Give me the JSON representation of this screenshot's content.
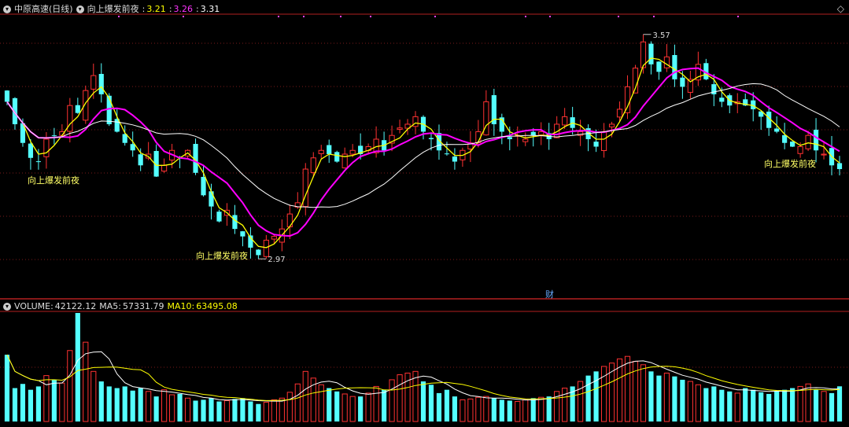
{
  "header": {
    "stock_name": "中原高速",
    "period": "(日线)",
    "indicator_name": "向上爆发前夜",
    "sep": ":",
    "values": [
      {
        "text": "3.21",
        "color": "#ffff00"
      },
      {
        "text": "3.26",
        "color": "#ff33ff"
      },
      {
        "text": "3.31",
        "color": "#ffffff"
      }
    ],
    "toggle_icon": "chevron-down-icon",
    "corner_icon": "diamond-icon"
  },
  "annotations": {
    "signal_label": "向上爆发前夜",
    "low_price": "2.97",
    "high_price": "3.57",
    "finance_marker": "财"
  },
  "volume_header": {
    "volume_label": "VOLUME:",
    "volume_value": "42122.12",
    "ma5_label": "MA5:",
    "ma5_value": "57331.79",
    "ma10_label": "MA10:",
    "ma10_value": "63495.08"
  },
  "colors": {
    "up": "#ff3232",
    "down": "#54ffff",
    "ma_yellow": "#ffff00",
    "ma_magenta": "#ff00ff",
    "ma_white": "#ffffff",
    "grid": "#7a1a1a",
    "frame": "#b22020",
    "label_yellow": "#ffff66"
  },
  "chart_data": {
    "type": "candlestick",
    "price_range": [
      2.88,
      3.62
    ],
    "price_high": 3.57,
    "price_low": 2.97,
    "closes": [
      3.39,
      3.33,
      3.28,
      3.24,
      3.23,
      3.29,
      3.3,
      3.31,
      3.38,
      3.36,
      3.42,
      3.46,
      3.41,
      3.33,
      3.31,
      3.28,
      3.26,
      3.22,
      3.25,
      3.19,
      3.22,
      3.26,
      3.24,
      3.26,
      3.2,
      3.14,
      3.11,
      3.07,
      3.1,
      3.05,
      3.03,
      3.0,
      2.98,
      3.02,
      3.03,
      3.05,
      3.09,
      3.12,
      3.21,
      3.24,
      3.26,
      3.25,
      3.23,
      3.25,
      3.26,
      3.25,
      3.27,
      3.29,
      3.26,
      3.3,
      3.32,
      3.33,
      3.35,
      3.31,
      3.29,
      3.26,
      3.25,
      3.23,
      3.26,
      3.28,
      3.31,
      3.39,
      3.33,
      3.31,
      3.29,
      3.3,
      3.29,
      3.3,
      3.31,
      3.29,
      3.33,
      3.35,
      3.32,
      3.31,
      3.29,
      3.27,
      3.31,
      3.33,
      3.37,
      3.43,
      3.48,
      3.55,
      3.49,
      3.47,
      3.51,
      3.45,
      3.43,
      3.45,
      3.49,
      3.45,
      3.41,
      3.39,
      3.38,
      3.39,
      3.38,
      3.37,
      3.35,
      3.32,
      3.31,
      3.28,
      3.27,
      3.27,
      3.3,
      3.26,
      3.25,
      3.22,
      3.21
    ],
    "volume_range": [
      0,
      130000
    ],
    "volumes": [
      80000,
      40000,
      45000,
      38000,
      42000,
      55000,
      50000,
      46000,
      85000,
      130000,
      95000,
      60000,
      48000,
      42000,
      40000,
      42000,
      37000,
      40000,
      36000,
      30000,
      38000,
      32000,
      33000,
      28000,
      25000,
      26000,
      28000,
      24000,
      25000,
      27000,
      28000,
      24000,
      21000,
      23000,
      26000,
      28000,
      35000,
      45000,
      60000,
      52000,
      44000,
      40000,
      36000,
      33000,
      30000,
      30000,
      34000,
      42000,
      38000,
      50000,
      56000,
      58000,
      60000,
      48000,
      44000,
      34000,
      38000,
      30000,
      26000,
      27000,
      29000,
      30000,
      28000,
      26000,
      25000,
      24000,
      26000,
      28000,
      29000,
      30000,
      36000,
      40000,
      42000,
      48000,
      55000,
      60000,
      66000,
      70000,
      75000,
      78000,
      72000,
      68000,
      60000,
      55000,
      58000,
      54000,
      50000,
      48000,
      44000,
      40000,
      42000,
      38000,
      36000,
      34000,
      40000,
      38000,
      35000,
      33000,
      36000,
      38000,
      40000,
      42000,
      45000,
      38000,
      36000,
      34000,
      42122
    ]
  }
}
